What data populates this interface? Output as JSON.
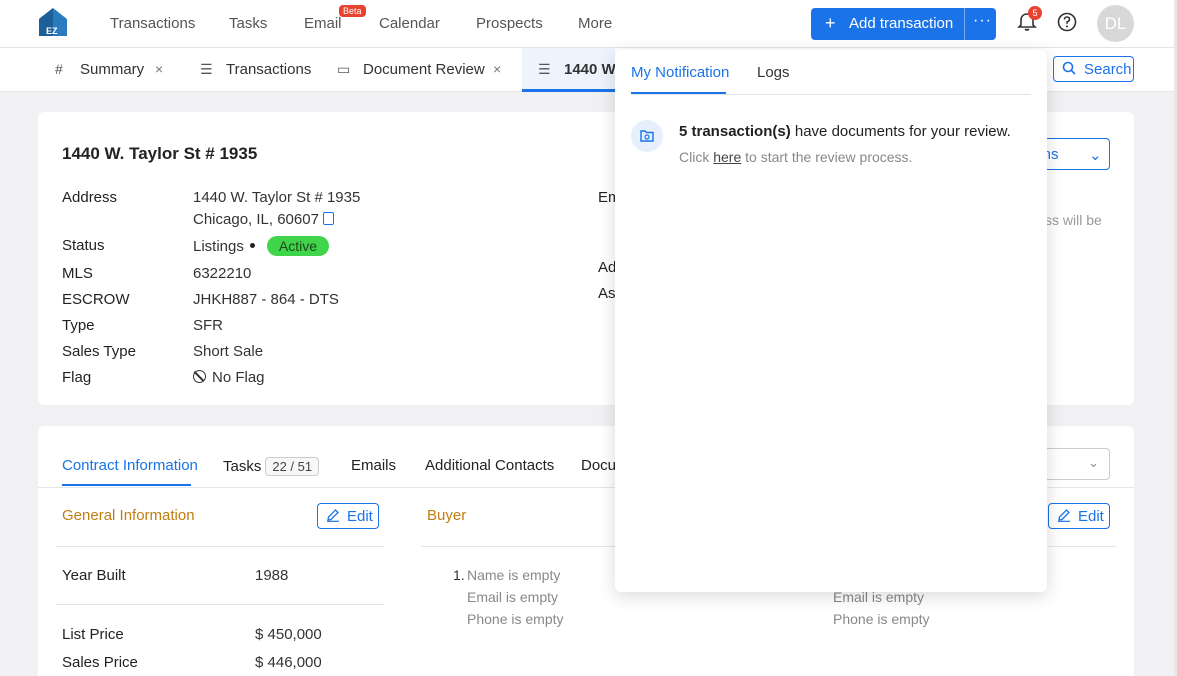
{
  "app": {
    "logo_text": "EZ"
  },
  "topnav": {
    "items": [
      "Transactions",
      "Tasks",
      "Email",
      "Calendar",
      "Prospects",
      "More"
    ],
    "email_badge": "Beta",
    "add_transaction": "Add transaction",
    "more_dots": "···",
    "notif_count": "5",
    "avatar_initials": "DL"
  },
  "tabs": [
    {
      "label": "Summary",
      "closable": true
    },
    {
      "label": "Transactions",
      "closable": false
    },
    {
      "label": "Document Review",
      "closable": true
    },
    {
      "label": "1440 W"
    }
  ],
  "search_label": "Search",
  "property": {
    "title": "1440 W. Taylor St # 1935",
    "fields": {
      "address_label": "Address",
      "address_line1": "1440 W. Taylor St # 1935",
      "address_line2": "Chicago, IL, 60607",
      "status_label": "Status",
      "status_value": "Listings",
      "status_badge": "Active",
      "mls_label": "MLS",
      "mls_value": "6322210",
      "escrow_label": "ESCROW",
      "escrow_value": "JHKH887 - 864 - DTS",
      "type_label": "Type",
      "type_value": "SFR",
      "sales_type_label": "Sales Type",
      "sales_type_value": "Short Sale",
      "flag_label": "Flag",
      "flag_value": "No Flag"
    },
    "right_labels": [
      "Em",
      "Ad",
      "As"
    ],
    "actions_label": "ions",
    "faded_text": "ss will be"
  },
  "details": {
    "tabs": [
      "Contract Information",
      "Tasks",
      "Emails",
      "Additional Contacts",
      "Docu"
    ],
    "tasks_count": "22 / 51",
    "general_title": "General Information",
    "buyer_title": "Buyer",
    "edit_label": "Edit",
    "general": {
      "year_built_label": "Year Built",
      "year_built_value": "1988",
      "list_price_label": "List Price",
      "list_price_value": "$ 450,000",
      "sales_price_label": "Sales Price",
      "sales_price_value": "$ 446,000"
    },
    "buyer": {
      "number": "1.",
      "name_empty": "Name is empty",
      "email_empty": "Email is empty",
      "phone_empty": "Phone is empty"
    }
  },
  "notifications": {
    "tabs": [
      "My Notification",
      "Logs"
    ],
    "item": {
      "bold": "5 transaction(s)",
      "rest": " have documents for your review.",
      "click": "Click ",
      "here": "here",
      "after": " to start the review process."
    }
  }
}
